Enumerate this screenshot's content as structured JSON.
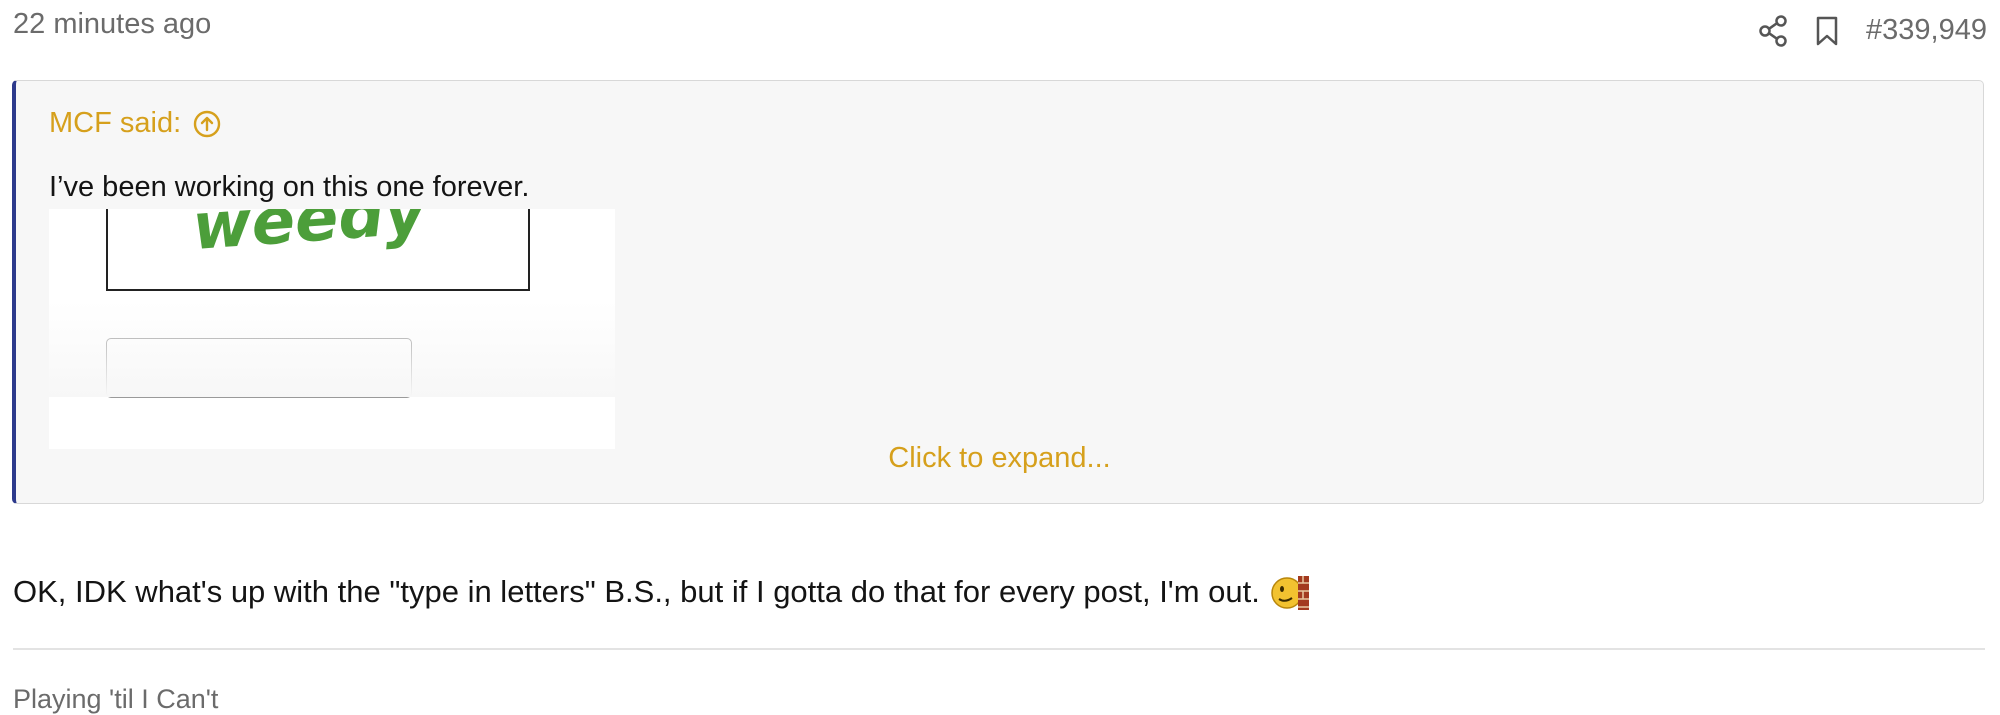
{
  "post": {
    "timestamp": "22 minutes ago",
    "number": "#339,949",
    "actions": {
      "share_icon": "share-icon",
      "bookmark_icon": "bookmark-icon"
    }
  },
  "quote": {
    "author_label": "MCF said:",
    "jump_icon": "arrow-up-circle-icon",
    "text": "I’ve been working on this one forever.",
    "captcha_text": "weedy",
    "expand_label": "Click to expand..."
  },
  "body": {
    "message": "OK, IDK what's up with the \"type in letters\" B.S., but if I gotta do that for every post, I'm out.",
    "emoji": "banging-head-emoji"
  },
  "signature": {
    "text": "Playing 'til I Can't"
  },
  "colors": {
    "accent": "#d6a01c",
    "quote_border": "#2d3a8c",
    "quote_bg": "#f7f7f7",
    "muted_text": "#6b6b6b"
  }
}
